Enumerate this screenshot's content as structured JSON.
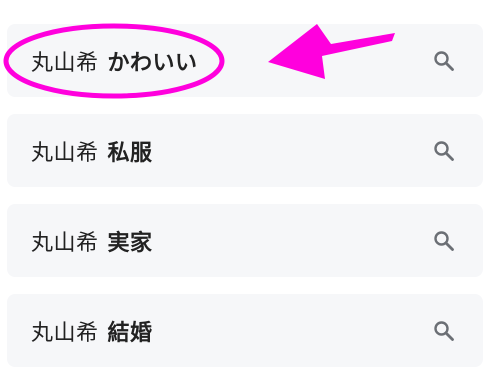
{
  "suggestions": [
    {
      "prefix": "丸山希",
      "suffix": "かわいい",
      "icon": "search-icon"
    },
    {
      "prefix": "丸山希",
      "suffix": "私服",
      "icon": "search-icon"
    },
    {
      "prefix": "丸山希",
      "suffix": "実家",
      "icon": "search-icon"
    },
    {
      "prefix": "丸山希",
      "suffix": "結婚",
      "icon": "search-icon"
    }
  ],
  "colors": {
    "row_background": "#f6f7f9",
    "text": "#222222",
    "icon": "#6b6f75",
    "annotation": "#ff00dd"
  }
}
